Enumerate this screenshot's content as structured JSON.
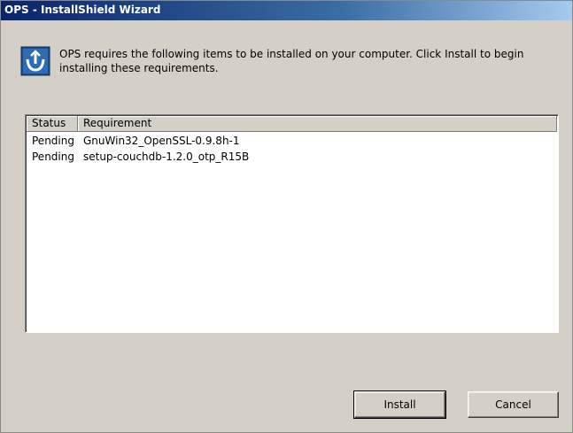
{
  "window": {
    "title": "OPS - InstallShield Wizard"
  },
  "header": {
    "icon": "installshield-icon",
    "message": "OPS requires the following items to be installed on your computer. Click Install to begin installing these requirements."
  },
  "requirements": {
    "columns": [
      "Status",
      "Requirement"
    ],
    "rows": [
      {
        "status": "Pending",
        "requirement": "GnuWin32_OpenSSL-0.9.8h-1"
      },
      {
        "status": "Pending",
        "requirement": "setup-couchdb-1.2.0_otp_R15B"
      }
    ]
  },
  "buttons": {
    "install": "Install",
    "cancel": "Cancel"
  }
}
